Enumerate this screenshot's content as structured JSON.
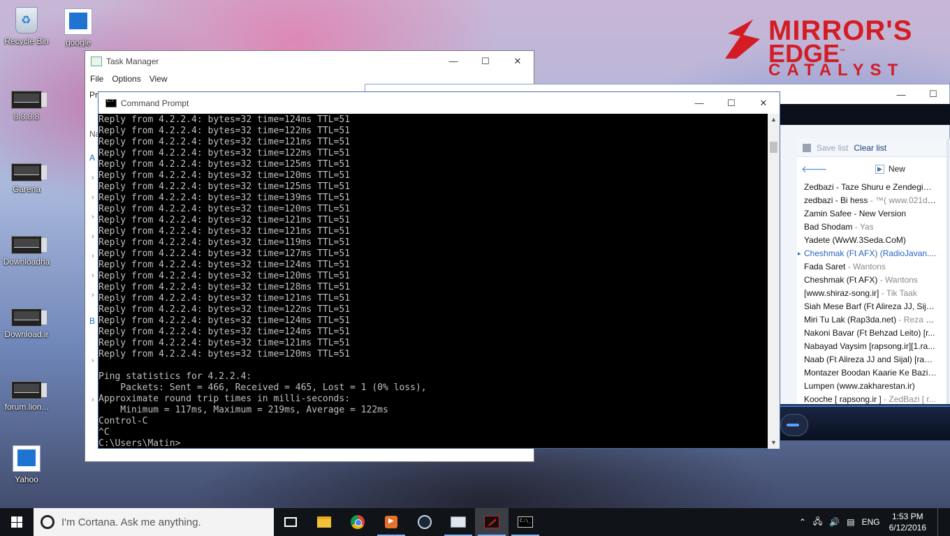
{
  "desktop": {
    "icons": [
      {
        "label": "Recycle Bin"
      },
      {
        "label": "google"
      },
      {
        "label": "8.8.8.8"
      },
      {
        "label": "Garena"
      },
      {
        "label": "Downloadha"
      },
      {
        "label": "Download.ir"
      },
      {
        "label": "forum.lion..."
      },
      {
        "label": "Yahoo"
      }
    ]
  },
  "logo": {
    "line1": "MIRROR'S",
    "line1b": "EDGE",
    "tm": "™",
    "line2": "CATALYST",
    "color": "#d41c24"
  },
  "task_manager": {
    "title": "Task Manager",
    "menu": [
      "File",
      "Options",
      "View"
    ],
    "tab_fragment": "Pr",
    "side_fragments": [
      "Na",
      "A",
      "B"
    ],
    "controls": {
      "minimize": "—",
      "maximize": "☐",
      "close": "✕"
    }
  },
  "media_player": {
    "save_list": "Save list",
    "clear_list": "Clear list",
    "back": "🡐",
    "new_label": "New",
    "items": [
      {
        "title": "Zedbazi - Taze Shuru e Zendegim...",
        "artist": ""
      },
      {
        "title": "zedbazi - Bi hess",
        "artist": " - ™( www.021dl...."
      },
      {
        "title": "Zamin Safee - New Version",
        "artist": ""
      },
      {
        "title": "Bad Shodam",
        "artist": " - Yas"
      },
      {
        "title": "Yadete (WwW.3Seda.CoM)",
        "artist": ""
      },
      {
        "title": "Cheshmak (Ft AFX) (RadioJavan....",
        "artist": "",
        "playing": true
      },
      {
        "title": "Fada Saret",
        "artist": " - Wantons"
      },
      {
        "title": "Cheshmak (Ft AFX)",
        "artist": " - Wantons"
      },
      {
        "title": "[www.shiraz-song.ir]",
        "artist": " - Tik Taak"
      },
      {
        "title": "Siah Mese Barf (Ft Alireza JJ, Sijal, ...",
        "artist": ""
      },
      {
        "title": "Miri Tu Lak (Rap3da.net)",
        "artist": " - Reza Pi..."
      },
      {
        "title": "Nakoni Bavar (Ft Behzad Leito) [r...",
        "artist": ""
      },
      {
        "title": "Nabayad Vaysim [rapsong.ir][1.ra...",
        "artist": ""
      },
      {
        "title": "Naab (Ft Alireza JJ and Sijal) [raps...",
        "artist": ""
      },
      {
        "title": "Montazer Boodan Kaarie Ke Bazi ...",
        "artist": ""
      },
      {
        "title": "Lumpen (www.zakharestan.ir)",
        "artist": ""
      },
      {
        "title": "Kooche [ rapsong.ir ]",
        "artist": " - ZedBazi [ r..."
      }
    ]
  },
  "cmd": {
    "title": "Command Prompt",
    "lines": [
      "Reply from 4.2.2.4: bytes=32 time=124ms TTL=51",
      "Reply from 4.2.2.4: bytes=32 time=122ms TTL=51",
      "Reply from 4.2.2.4: bytes=32 time=121ms TTL=51",
      "Reply from 4.2.2.4: bytes=32 time=122ms TTL=51",
      "Reply from 4.2.2.4: bytes=32 time=125ms TTL=51",
      "Reply from 4.2.2.4: bytes=32 time=120ms TTL=51",
      "Reply from 4.2.2.4: bytes=32 time=125ms TTL=51",
      "Reply from 4.2.2.4: bytes=32 time=139ms TTL=51",
      "Reply from 4.2.2.4: bytes=32 time=120ms TTL=51",
      "Reply from 4.2.2.4: bytes=32 time=121ms TTL=51",
      "Reply from 4.2.2.4: bytes=32 time=121ms TTL=51",
      "Reply from 4.2.2.4: bytes=32 time=119ms TTL=51",
      "Reply from 4.2.2.4: bytes=32 time=127ms TTL=51",
      "Reply from 4.2.2.4: bytes=32 time=124ms TTL=51",
      "Reply from 4.2.2.4: bytes=32 time=120ms TTL=51",
      "Reply from 4.2.2.4: bytes=32 time=128ms TTL=51",
      "Reply from 4.2.2.4: bytes=32 time=121ms TTL=51",
      "Reply from 4.2.2.4: bytes=32 time=122ms TTL=51",
      "Reply from 4.2.2.4: bytes=32 time=124ms TTL=51",
      "Reply from 4.2.2.4: bytes=32 time=124ms TTL=51",
      "Reply from 4.2.2.4: bytes=32 time=121ms TTL=51",
      "Reply from 4.2.2.4: bytes=32 time=120ms TTL=51",
      "",
      "Ping statistics for 4.2.2.4:",
      "    Packets: Sent = 466, Received = 465, Lost = 1 (0% loss),",
      "Approximate round trip times in milli-seconds:",
      "    Minimum = 117ms, Maximum = 219ms, Average = 122ms",
      "Control-C",
      "^C",
      "C:\\Users\\Matin>"
    ]
  },
  "taskbar": {
    "cortana_placeholder": "I'm Cortana. Ask me anything.",
    "language": "ENG",
    "time": "1:53 PM",
    "date": "6/12/2016"
  }
}
